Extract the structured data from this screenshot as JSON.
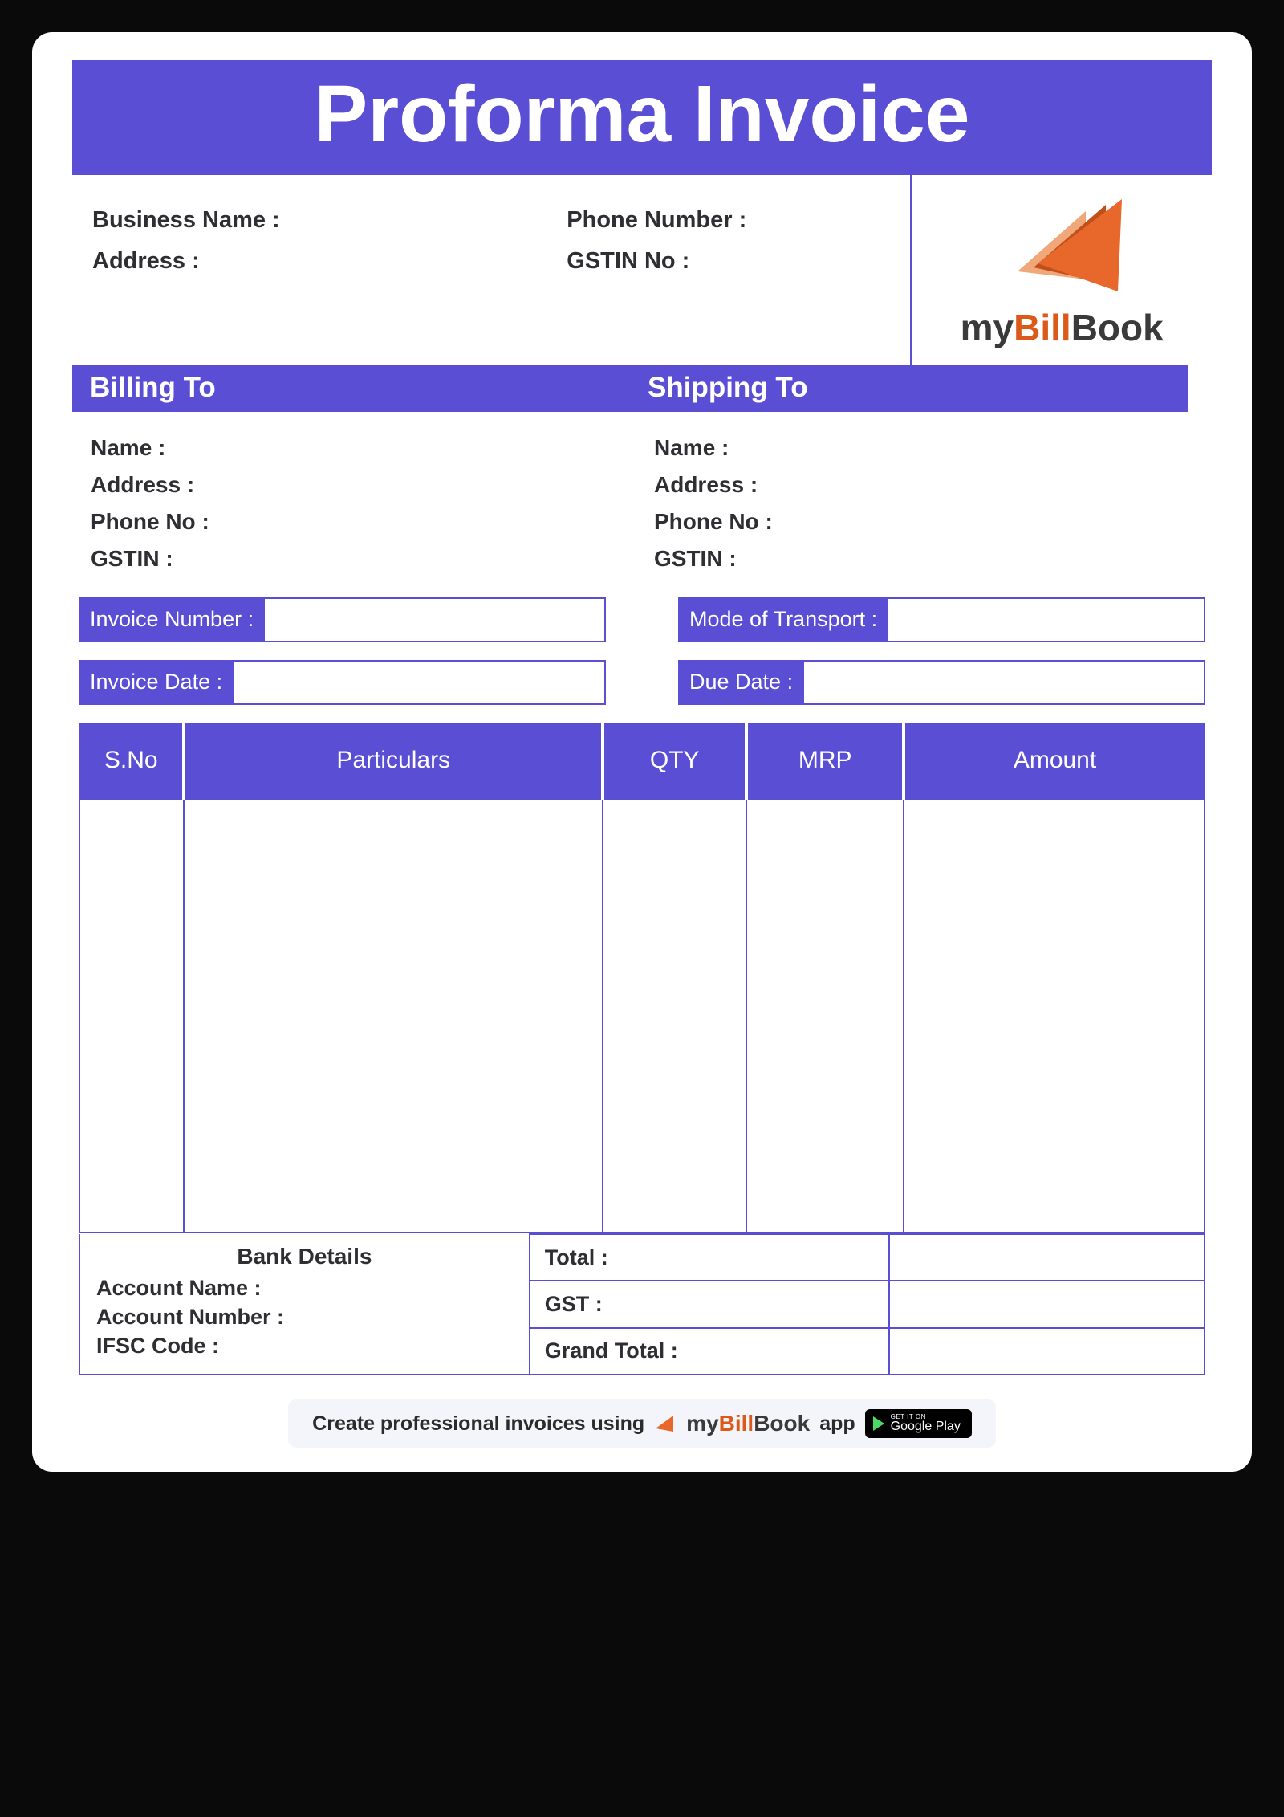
{
  "title": "Proforma Invoice",
  "business": {
    "name_label": "Business Name :",
    "address_label": "Address :",
    "phone_label": "Phone Number :",
    "gstin_label": "GSTIN No :"
  },
  "logo": {
    "text_my": "my",
    "text_bill": "Bill",
    "text_book": "Book"
  },
  "section": {
    "billing": "Billing To",
    "shipping": "Shipping To"
  },
  "billing": {
    "name": "Name :",
    "address": "Address :",
    "phone": "Phone No :",
    "gstin": "GSTIN :"
  },
  "shipping": {
    "name": "Name :",
    "address": "Address :",
    "phone": "Phone No :",
    "gstin": "GSTIN :"
  },
  "meta": {
    "invoice_number": "Invoice Number :",
    "mode_transport": "Mode of Transport :",
    "invoice_date": "Invoice Date :",
    "due_date": "Due Date :"
  },
  "table": {
    "headers": {
      "sno": "S.No",
      "particulars": "Particulars",
      "qty": "QTY",
      "mrp": "MRP",
      "amount": "Amount"
    }
  },
  "bank": {
    "title": "Bank Details",
    "account_name": "Account Name :",
    "account_number": "Account Number :",
    "ifsc": "IFSC Code :"
  },
  "totals": {
    "total": "Total :",
    "gst": "GST :",
    "grand": "Grand Total :"
  },
  "footer": {
    "text1": "Create professional invoices using",
    "text2": "app",
    "gplay_top": "GET IT ON",
    "gplay_bottom": "Google Play"
  }
}
